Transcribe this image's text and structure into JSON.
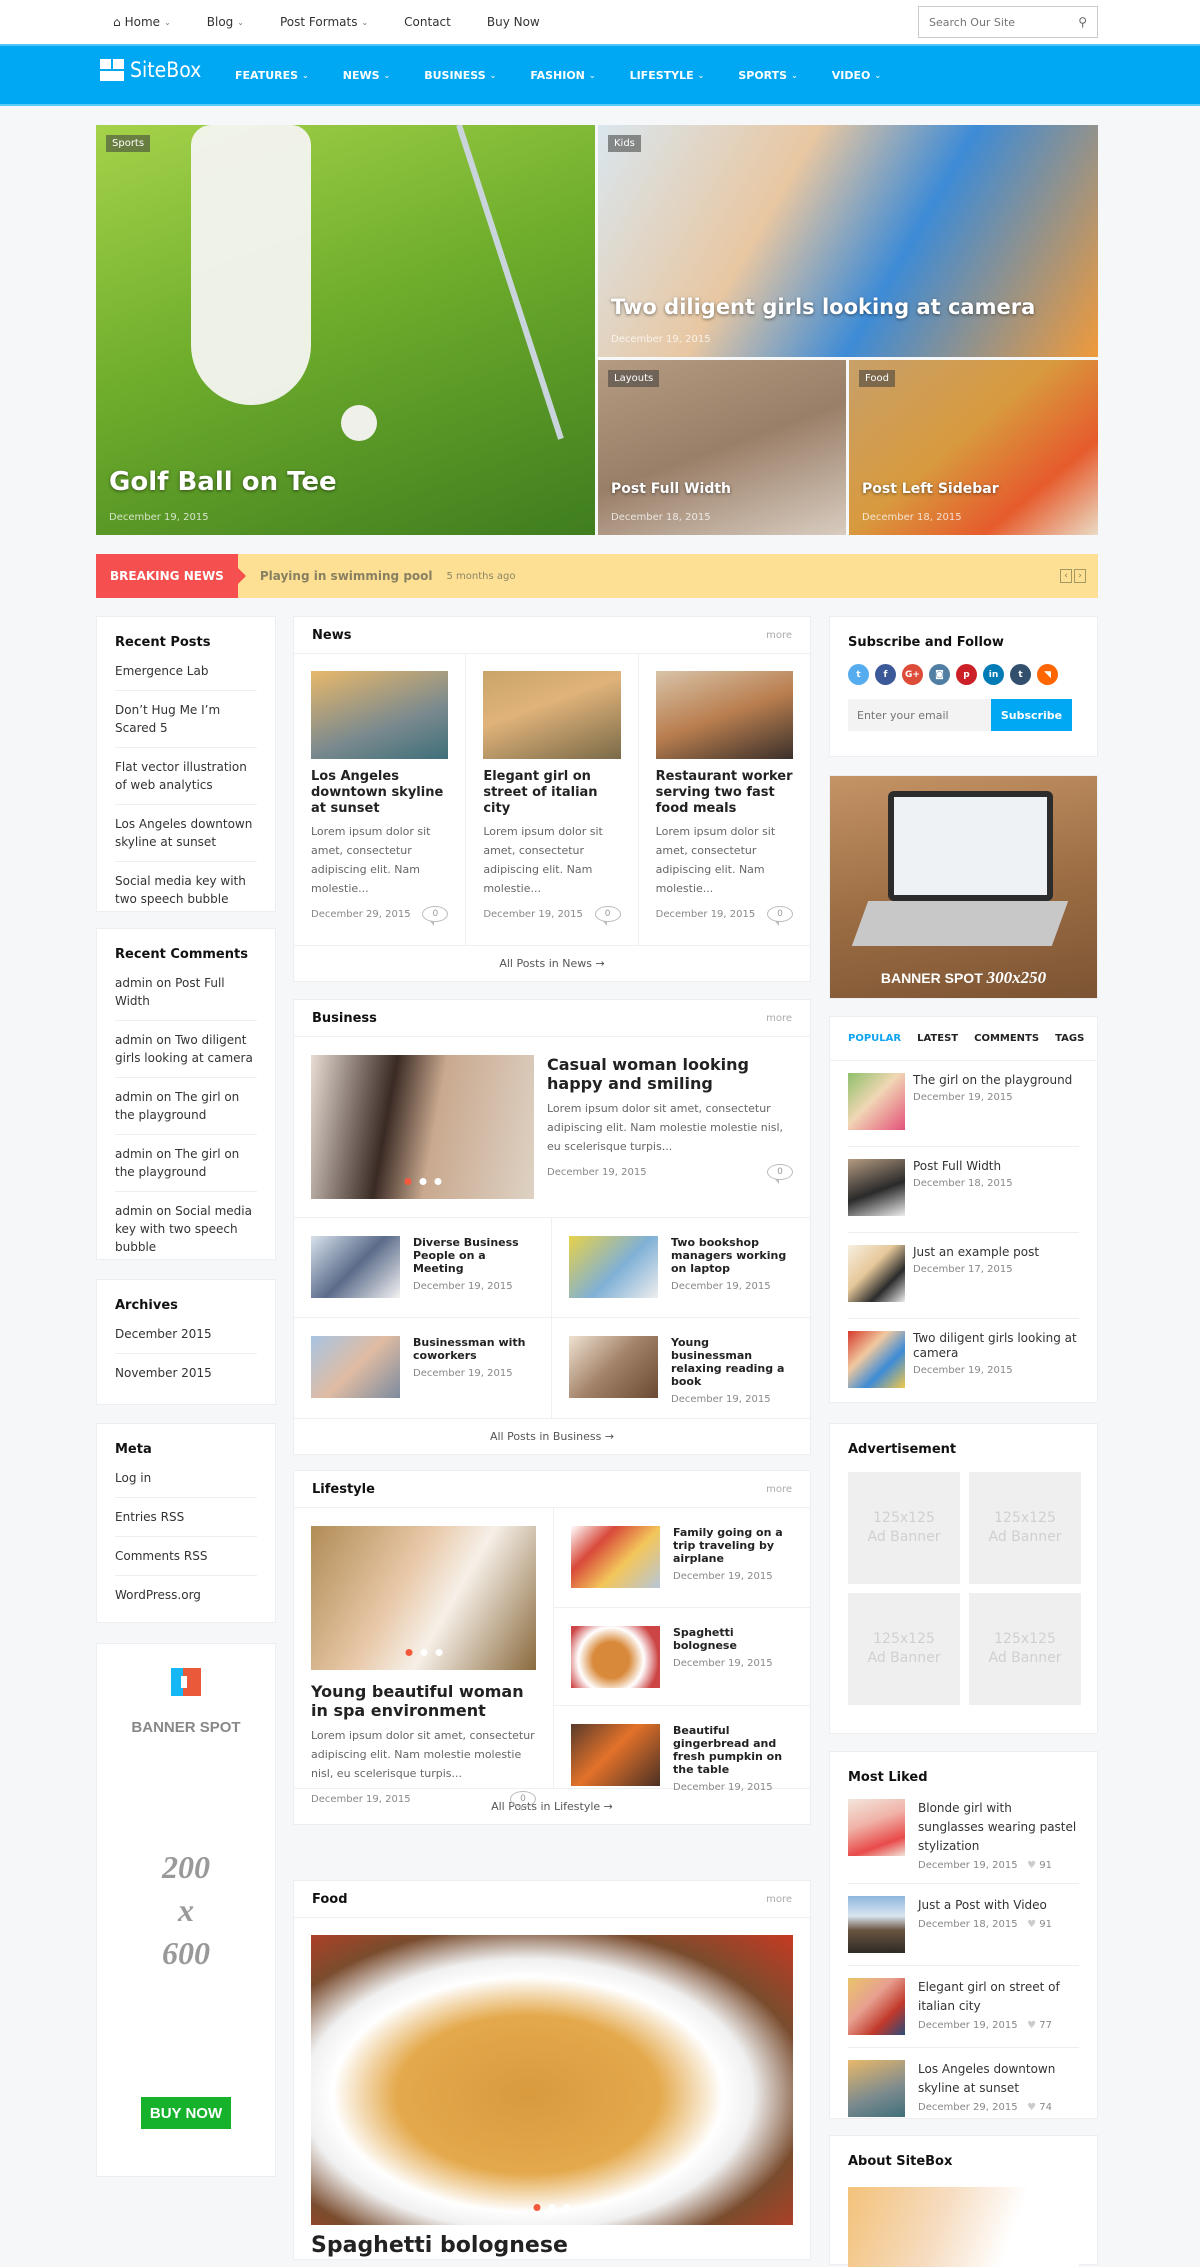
{
  "topnav": {
    "items": [
      {
        "label": "Home",
        "icon": "home-icon",
        "dropdown": true
      },
      {
        "label": "Blog",
        "dropdown": true
      },
      {
        "label": "Post Formats",
        "dropdown": true
      },
      {
        "label": "Contact",
        "dropdown": false
      },
      {
        "label": "Buy Now",
        "dropdown": false
      }
    ],
    "search_placeholder": "Search Our Site"
  },
  "brand": {
    "name": "SiteBox",
    "color": "#00a8f3"
  },
  "mainnav": {
    "items": [
      "FEATURES",
      "NEWS",
      "BUSINESS",
      "FASHION",
      "LIFESTYLE",
      "SPORTS",
      "VIDEO"
    ]
  },
  "hero": [
    {
      "category": "Sports",
      "title": "Golf Ball on Tee",
      "date": "December 19, 2015"
    },
    {
      "category": "Kids",
      "title": "Two diligent girls looking at camera",
      "date": "December 19, 2015"
    },
    {
      "category": "Layouts",
      "title": "Post Full Width",
      "date": "December 18, 2015"
    },
    {
      "category": "Food",
      "title": "Post Left Sidebar",
      "date": "December 18, 2015"
    }
  ],
  "breaking": {
    "label": "BREAKING NEWS",
    "headline": "Playing in swimming pool",
    "ago": "5 months ago",
    "prev": "‹",
    "next": "›",
    "color": "#f5504f"
  },
  "left": {
    "recent_posts": {
      "title": "Recent Posts",
      "items": [
        "Emergence Lab",
        "Don’t Hug Me I’m Scared 5",
        "Flat vector illustration of web analytics",
        "Los Angeles downtown skyline at sunset",
        "Social media key with two speech bubble"
      ]
    },
    "recent_comments": {
      "title": "Recent Comments",
      "items": [
        "admin on Post Full Width",
        "admin on Two diligent girls looking at camera",
        "admin on The girl on the playground",
        "admin on The girl on the playground",
        "admin on Social media key with two speech bubble"
      ]
    },
    "archives": {
      "title": "Archives",
      "items": [
        "December 2015",
        "November 2015"
      ]
    },
    "meta": {
      "title": "Meta",
      "items": [
        "Log in",
        "Entries RSS",
        "Comments RSS",
        "WordPress.org"
      ]
    },
    "banner": {
      "label": "BANNER SPOT",
      "size_w": "200",
      "size_x": "x",
      "size_h": "600",
      "button": "BUY NOW"
    }
  },
  "news": {
    "title": "News",
    "more": "more",
    "footer": "All Posts in News →",
    "items": [
      {
        "title": "Los Angeles downtown skyline at sunset",
        "excerpt": "Lorem ipsum dolor sit amet, consectetur adipiscing elit. Nam molestie...",
        "date": "December 29, 2015",
        "comments": "0"
      },
      {
        "title": "Elegant girl on street of italian city",
        "excerpt": "Lorem ipsum dolor sit amet, consectetur adipiscing elit. Nam molestie...",
        "date": "December 19, 2015",
        "comments": "0"
      },
      {
        "title": "Restaurant worker serving two fast food meals",
        "excerpt": "Lorem ipsum dolor sit amet, consectetur adipiscing elit. Nam molestie...",
        "date": "December 19, 2015",
        "comments": "0"
      }
    ]
  },
  "business": {
    "title": "Business",
    "more": "more",
    "footer": "All Posts in Business →",
    "featured": {
      "title": "Casual woman looking happy and smiling",
      "excerpt": "Lorem ipsum dolor sit amet, consectetur adipiscing elit. Nam molestie molestie nisl, eu scelerisque turpis...",
      "date": "December 19, 2015",
      "comments": "0"
    },
    "items": [
      {
        "title": "Diverse Business People on a Meeting",
        "date": "December 19, 2015"
      },
      {
        "title": "Two bookshop managers working on laptop",
        "date": "December 19, 2015"
      },
      {
        "title": "Businessman with coworkers",
        "date": "December 19, 2015"
      },
      {
        "title": "Young businessman relaxing reading a book",
        "date": "December 19, 2015"
      }
    ]
  },
  "lifestyle": {
    "title": "Lifestyle",
    "more": "more",
    "footer": "All Posts in Lifestyle →",
    "featured": {
      "title": "Young beautiful woman in spa environment",
      "excerpt": "Lorem ipsum dolor sit amet, consectetur adipiscing elit. Nam molestie molestie nisl, eu scelerisque turpis...",
      "date": "December 19, 2015",
      "comments": "0"
    },
    "items": [
      {
        "title": "Family going on a trip traveling by airplane",
        "date": "December 19, 2015"
      },
      {
        "title": "Spaghetti bolognese",
        "date": "December 19, 2015"
      },
      {
        "title": "Beautiful gingerbread and fresh pumpkin on the table",
        "date": "December 19, 2015"
      }
    ]
  },
  "food": {
    "title": "Food",
    "more": "more",
    "featured_title": "Spaghetti bolognese"
  },
  "right": {
    "subscribe": {
      "title": "Subscribe and Follow",
      "email_placeholder": "Enter your email",
      "button": "Subscribe",
      "social": [
        {
          "name": "twitter",
          "glyph": "t",
          "color": "#55acee"
        },
        {
          "name": "facebook",
          "glyph": "f",
          "color": "#3b5998"
        },
        {
          "name": "google-plus",
          "glyph": "G+",
          "color": "#dd4b39"
        },
        {
          "name": "instagram",
          "glyph": "◙",
          "color": "#517fa4"
        },
        {
          "name": "pinterest",
          "glyph": "p",
          "color": "#cb2027"
        },
        {
          "name": "linkedin",
          "glyph": "in",
          "color": "#007bb6"
        },
        {
          "name": "tumblr",
          "glyph": "t",
          "color": "#32506d"
        },
        {
          "name": "rss",
          "glyph": "◥",
          "color": "#ff6600"
        }
      ]
    },
    "banner": {
      "label": "BANNER SPOT",
      "size": "300x250"
    },
    "tabs": {
      "items": [
        "POPULAR",
        "LATEST",
        "COMMENTS",
        "TAGS"
      ],
      "active": "POPULAR",
      "posts": [
        {
          "title": "The girl on the playground",
          "date": "December 19, 2015"
        },
        {
          "title": "Post Full Width",
          "date": "December 18, 2015"
        },
        {
          "title": "Just an example post",
          "date": "December 17, 2015"
        },
        {
          "title": "Two diligent girls looking at camera",
          "date": "December 19, 2015"
        }
      ]
    },
    "ads": {
      "title": "Advertisement",
      "items": [
        {
          "size": "125x125",
          "label": "Ad Banner"
        },
        {
          "size": "125x125",
          "label": "Ad Banner"
        },
        {
          "size": "125x125",
          "label": "Ad Banner"
        },
        {
          "size": "125x125",
          "label": "Ad Banner"
        }
      ]
    },
    "most_liked": {
      "title": "Most Liked",
      "items": [
        {
          "title": "Blonde girl with sunglasses wearing pastel stylization",
          "date": "December 19, 2015",
          "likes": "91"
        },
        {
          "title": "Just a Post with Video",
          "date": "December 18, 2015",
          "likes": "91"
        },
        {
          "title": "Elegant girl on street of italian city",
          "date": "December 19, 2015",
          "likes": "77"
        },
        {
          "title": "Los Angeles downtown skyline at sunset",
          "date": "December 29, 2015",
          "likes": "74"
        }
      ]
    },
    "about": {
      "title": "About SiteBox"
    }
  }
}
